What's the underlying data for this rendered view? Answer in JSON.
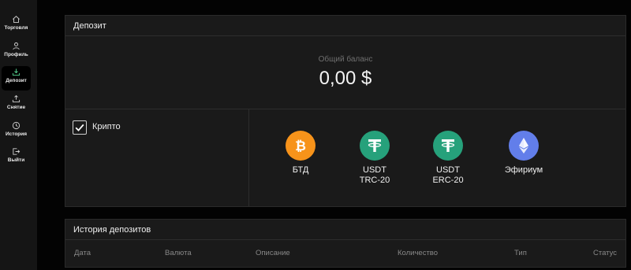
{
  "sidebar": {
    "items": [
      {
        "label": "Торговля",
        "icon": "home-icon"
      },
      {
        "label": "Профиль",
        "icon": "user-icon"
      },
      {
        "label": "Депозит",
        "icon": "deposit-icon",
        "active": true
      },
      {
        "label": "Снятие",
        "icon": "withdraw-icon"
      },
      {
        "label": "История",
        "icon": "clock-icon"
      },
      {
        "label": "Выйти",
        "icon": "logout-icon"
      }
    ]
  },
  "deposit": {
    "title": "Депозит",
    "balance_label": "Общий баланс",
    "balance_value": "0,00 $",
    "method_label": "Крипто",
    "method_checked": true,
    "coins": [
      {
        "name": "БТД",
        "icon": "bitcoin-icon",
        "color": "#f7931a"
      },
      {
        "name": "USDT\nTRC-20",
        "icon": "tether-icon",
        "color": "#26a17b"
      },
      {
        "name": "USDT\nERC-20",
        "icon": "tether-icon",
        "color": "#26a17b"
      },
      {
        "name": "Эфириум",
        "icon": "ethereum-icon",
        "color": "#627eea"
      }
    ]
  },
  "history": {
    "title": "История депозитов",
    "columns": [
      "Дата",
      "Валюта",
      "Описание",
      "Количество",
      "Тип",
      "Статус"
    ]
  },
  "colors": {
    "accent": "#55d28f",
    "panel": "#1a1a1a",
    "background": "#030303"
  }
}
